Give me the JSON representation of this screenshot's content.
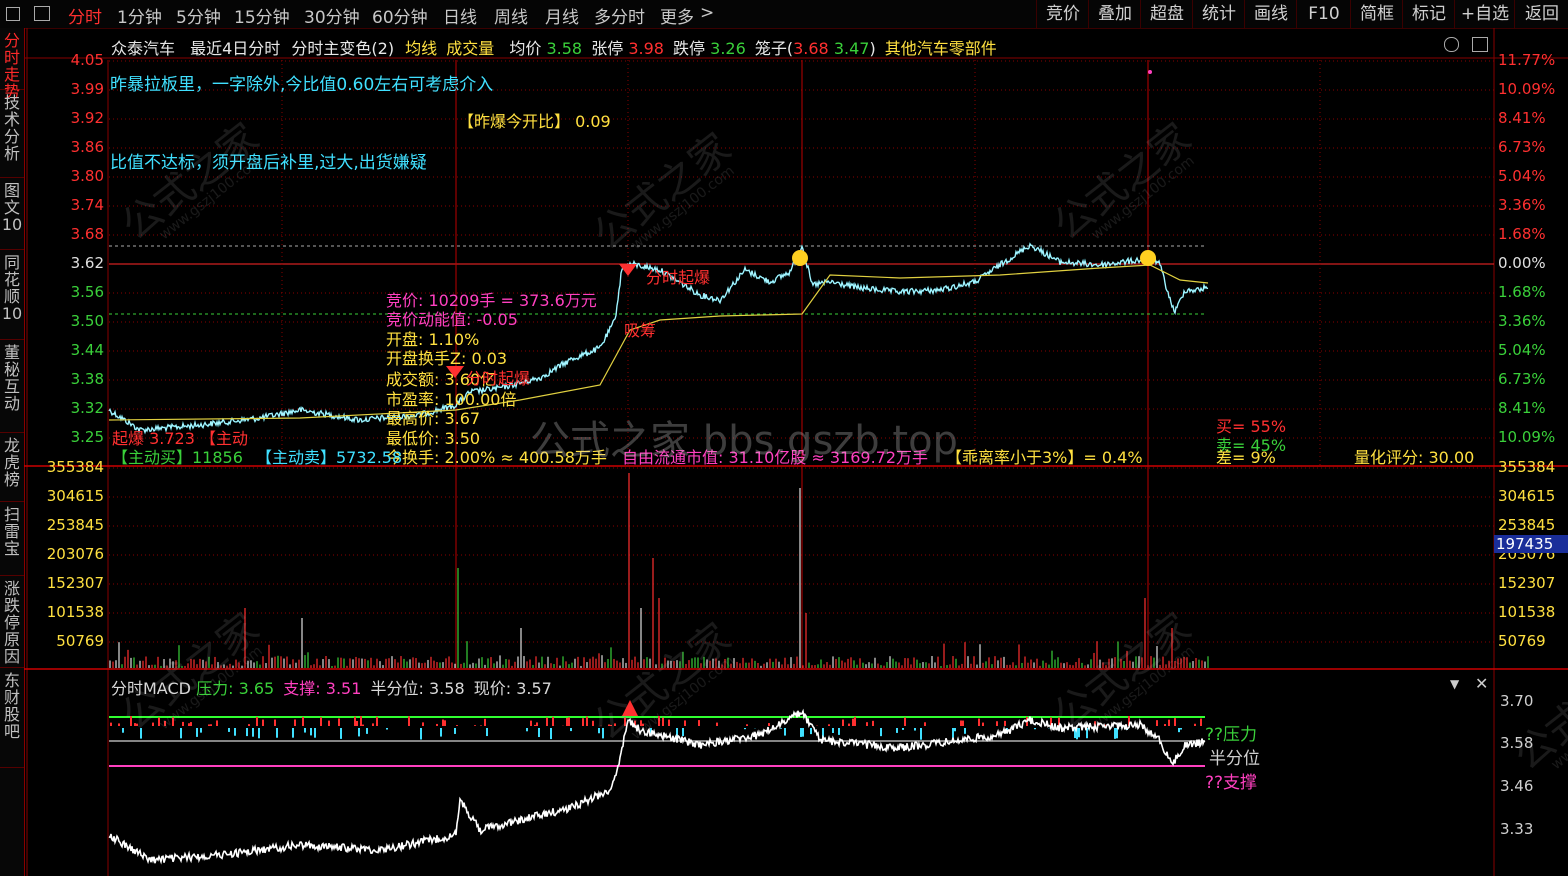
{
  "toolbar": {
    "tabs": [
      "分时",
      "1分钟",
      "5分钟",
      "15分钟",
      "30分钟",
      "60分钟",
      "日线",
      "周线",
      "月线",
      "多分时",
      "更多"
    ],
    "more_arrow": ">",
    "buttons": [
      "竞价",
      "叠加",
      "超盘",
      "统计",
      "画线",
      "F10",
      "简框",
      "标记",
      "+自选",
      "返回"
    ]
  },
  "sidebar": [
    "分时走势",
    "技术分析",
    "图文10",
    "同花顺10",
    "董秘互动",
    "龙虎榜",
    "扫雷宝",
    "涨跌停原因",
    "东财股吧"
  ],
  "header": {
    "stock_name": "众泰汽车",
    "period": "最近4日分时",
    "indicator": "分时主变色(2)",
    "avg_line_label": "均线",
    "volume_label": "成交量",
    "avg_price_label": "均价",
    "avg_price": "3.58",
    "limit_up_label": "张停",
    "limit_up": "3.98",
    "limit_down_label": "跌停",
    "limit_down": "3.26",
    "cage_label": "笼子(",
    "cage_a": "3.68",
    "cage_b": "3.47",
    "cage_close": ")",
    "sector": "其他汽车零部件"
  },
  "colors": {
    "up": "#ff3030",
    "down": "#3ad03a",
    "price_line": "#7ff0ff",
    "avg_line": "#e0d040",
    "grid": "#8a0000",
    "pink": "#ff40c0",
    "yellow": "#ffe040",
    "cyan": "#40e0ff"
  },
  "price_axis": {
    "left": [
      "4.05",
      "3.99",
      "3.92",
      "3.86",
      "3.80",
      "3.74",
      "3.68",
      "3.62",
      "3.56",
      "3.50",
      "3.44",
      "3.38",
      "3.32",
      "3.25"
    ],
    "right": [
      "11.77%",
      "10.09%",
      "8.41%",
      "6.73%",
      "5.04%",
      "3.36%",
      "1.68%",
      "0.00%",
      "1.68%",
      "3.36%",
      "5.04%",
      "6.73%",
      "8.41%",
      "10.09%"
    ]
  },
  "volume_axis": {
    "left": [
      "355384",
      "304615",
      "253845",
      "203076",
      "152307",
      "101538",
      "50769"
    ],
    "right": [
      "355384",
      "304615",
      "253845",
      "203076",
      "152307",
      "101538",
      "50769"
    ],
    "current": "197435"
  },
  "annotations": {
    "line1": "昨暴拉板里，一字除外,今比值0.60左右可考虑介入",
    "ratio_label": "【昨爆今开比】",
    "ratio_value": "0.09",
    "line2": "比值不达标，须开盘后补里,过大,出货嫌疑",
    "bid": "竞价: 10209手 = 373.6万元",
    "bid_energy": "竞价动能值: -0.05",
    "open": "开盘: 1.10%",
    "open_turnover": "开盘换手Z: 0.03",
    "amount": "成交额: 3.60亿",
    "pe": "市盈率: 100.00倍",
    "high": "最高价: 3.67",
    "low": "最低价: 3.50",
    "turnover": "今换手: 2.00% ≈ 400.58万手",
    "float_cap": "自由流通市值: 31.10亿股 ≈ 3169.72万手",
    "deviation": "【乖离率小于3%】= 0.4%",
    "buy": "买= 55%",
    "sell": "卖= 45%",
    "diff": "差= 9%",
    "score_label": "量化评分:",
    "score": "30.00",
    "active_buy": "【主动买】11856",
    "active_sell": "【主动卖】5732.58",
    "limit1": "分时起爆",
    "limit2": "分时起爆",
    "suck": "吸筹",
    "left_mark": "起爆 3.723 【主动"
  },
  "macd": {
    "title": "分时MACD",
    "pressure_label": "压力:",
    "pressure": "3.65",
    "support_label": "支撑:",
    "support": "3.51",
    "half_label": "半分位:",
    "half": "3.58",
    "now_label": "现价:",
    "now": "3.57",
    "tag_pressure": "??压力",
    "tag_half": "半分位",
    "tag_support": "??支撑",
    "axis": [
      "3.70",
      "3.58",
      "3.46",
      "3.33"
    ]
  },
  "watermark": {
    "big": "公式之家 bbs.gszb.top",
    "small": "公式之家",
    "small_url": "www.gszj100.com"
  }
}
